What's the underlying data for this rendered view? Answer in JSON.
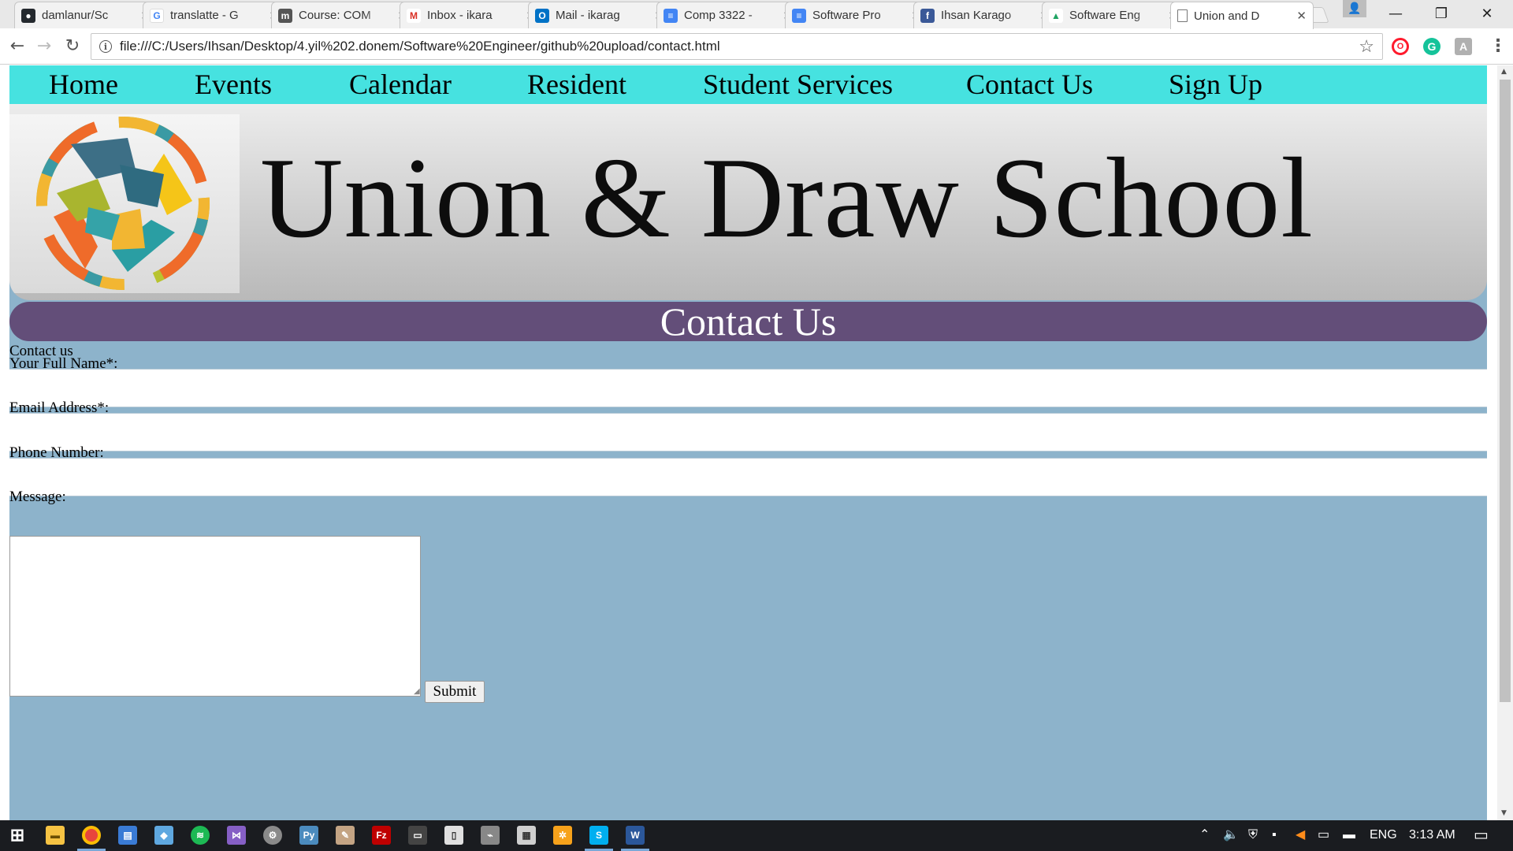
{
  "browser": {
    "tabs": [
      {
        "title": "damlanur/Sc",
        "icon": "github-icon",
        "fav_color": "#24292e",
        "fav_glyph": "●"
      },
      {
        "title": "translatte - G",
        "icon": "google-icon",
        "fav_color": "#4285f4",
        "fav_glyph": "G"
      },
      {
        "title": "Course: COM",
        "icon": "moodle-icon",
        "fav_color": "#555555",
        "fav_glyph": "m"
      },
      {
        "title": "Inbox - ikara",
        "icon": "gmail-icon",
        "fav_color": "#d93025",
        "fav_glyph": "M"
      },
      {
        "title": "Mail - ikarag",
        "icon": "outlook-icon",
        "fav_color": "#0072c6",
        "fav_glyph": "O"
      },
      {
        "title": "Comp 3322 -",
        "icon": "google-docs-icon",
        "fav_color": "#4285f4",
        "fav_glyph": "≡"
      },
      {
        "title": "Software Pro",
        "icon": "google-docs-icon",
        "fav_color": "#4285f4",
        "fav_glyph": "≡"
      },
      {
        "title": "Ihsan Karago",
        "icon": "facebook-icon",
        "fav_color": "#3b5998",
        "fav_glyph": "f"
      },
      {
        "title": "Software Eng",
        "icon": "google-drive-icon",
        "fav_color": "#1fa463",
        "fav_glyph": "▲"
      },
      {
        "title": "Union and D",
        "icon": "page-icon",
        "fav_color": "#ffffff",
        "fav_glyph": "",
        "active": true
      }
    ],
    "url": "file:///C:/Users/Ihsan/Desktop/4.yil%202.donem/Software%20Engineer/github%20upload/contact.html",
    "window_controls": {
      "minimize": "—",
      "restore": "❐",
      "close": "✕"
    }
  },
  "site": {
    "nav": [
      "Home",
      "Events",
      "Calendar",
      "Resident",
      "Student Services",
      "Contact Us",
      "Sign Up"
    ],
    "school_name": "Union & Draw School",
    "page_header": "Contact Us",
    "form": {
      "legend": "Contact us",
      "name_label": "Your Full Name*:",
      "email_label": "Email Address*:",
      "phone_label": "Phone Number:",
      "message_label": "Message:",
      "submit_label": "Submit",
      "name_value": "",
      "email_value": "",
      "phone_value": "",
      "message_value": ""
    }
  },
  "taskbar": {
    "apps": [
      {
        "name": "start-icon",
        "color": "#ffffff"
      },
      {
        "name": "file-explorer-icon",
        "color": "#f6c343"
      },
      {
        "name": "chrome-icon",
        "color": "#e8453c"
      },
      {
        "name": "task-manager-icon",
        "color": "#3a7bd5"
      },
      {
        "name": "box-app-icon",
        "color": "#5fa8e0"
      },
      {
        "name": "spotify-icon",
        "color": "#1db954"
      },
      {
        "name": "visual-studio-icon",
        "color": "#865fc5"
      },
      {
        "name": "steam-icon",
        "color": "#8a8a8a"
      },
      {
        "name": "python-icon",
        "color": "#4b8bbe"
      },
      {
        "name": "paint-icon",
        "color": "#c4a484"
      },
      {
        "name": "filezilla-icon",
        "color": "#bf0000"
      },
      {
        "name": "terminal-icon",
        "color": "#444444"
      },
      {
        "name": "notepad-icon",
        "color": "#e0e0e0"
      },
      {
        "name": "stapler-icon",
        "color": "#888888"
      },
      {
        "name": "calculator-icon",
        "color": "#cfcfcf"
      },
      {
        "name": "pinwheel-icon",
        "color": "#f7a21b"
      },
      {
        "name": "skype-icon",
        "color": "#00aff0"
      },
      {
        "name": "word-icon",
        "color": "#2b579a"
      }
    ],
    "language": "ENG",
    "clock": "3:13 AM"
  }
}
